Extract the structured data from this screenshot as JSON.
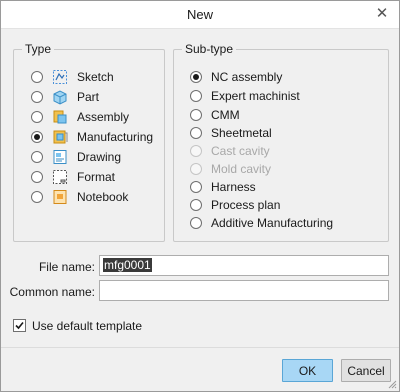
{
  "window": {
    "title": "New",
    "close_icon": "close-icon"
  },
  "type_group": {
    "label": "Type",
    "options": [
      {
        "label": "Sketch",
        "icon": "sketch-icon",
        "checked": false
      },
      {
        "label": "Part",
        "icon": "part-icon",
        "checked": false
      },
      {
        "label": "Assembly",
        "icon": "assembly-icon",
        "checked": false
      },
      {
        "label": "Manufacturing",
        "icon": "manufacturing-icon",
        "checked": true
      },
      {
        "label": "Drawing",
        "icon": "drawing-icon",
        "checked": false
      },
      {
        "label": "Format",
        "icon": "format-icon",
        "checked": false
      },
      {
        "label": "Notebook",
        "icon": "notebook-icon",
        "checked": false
      }
    ]
  },
  "subtype_group": {
    "label": "Sub-type",
    "options": [
      {
        "label": "NC assembly",
        "checked": true,
        "disabled": false
      },
      {
        "label": "Expert machinist",
        "checked": false,
        "disabled": false
      },
      {
        "label": "CMM",
        "checked": false,
        "disabled": false
      },
      {
        "label": "Sheetmetal",
        "checked": false,
        "disabled": false
      },
      {
        "label": "Cast cavity",
        "checked": false,
        "disabled": true
      },
      {
        "label": "Mold cavity",
        "checked": false,
        "disabled": true
      },
      {
        "label": "Harness",
        "checked": false,
        "disabled": false
      },
      {
        "label": "Process plan",
        "checked": false,
        "disabled": false
      },
      {
        "label": "Additive Manufacturing",
        "checked": false,
        "disabled": false
      }
    ]
  },
  "fields": {
    "file_name_label": "File name:",
    "file_name_value": "mfg0001",
    "common_name_label": "Common name:",
    "common_name_value": ""
  },
  "template": {
    "label": "Use default template",
    "checked": true
  },
  "buttons": {
    "ok": "OK",
    "cancel": "Cancel"
  },
  "colors": {
    "ok_button": "#a8d7f5",
    "ok_border": "#5aa6d6",
    "dialog_bg": "#f0f0f0"
  }
}
